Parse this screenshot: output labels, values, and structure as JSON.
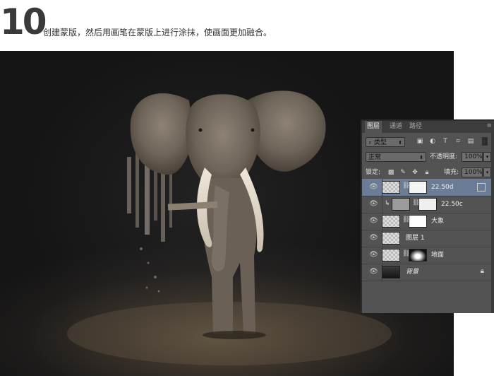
{
  "step": {
    "number": "10",
    "instruction": "创建蒙版，然后用画笔在蒙版上进行涂抹，使画面更加融合。"
  },
  "layers_panel": {
    "tabs": [
      "图层",
      "通道",
      "路径"
    ],
    "active_tab": "图层",
    "filter_label": "类型",
    "blend_mode": "正常",
    "opacity_label": "不透明度:",
    "opacity_value": "100%",
    "lock_label": "锁定:",
    "fill_label": "填充:",
    "fill_value": "100%",
    "layers": [
      {
        "name": "22.50d",
        "selected": true
      },
      {
        "name": "22.50c",
        "selected": false
      },
      {
        "name": "大象",
        "selected": false
      },
      {
        "name": "图层 1",
        "selected": false
      },
      {
        "name": "地面",
        "selected": false
      },
      {
        "name": "背景",
        "selected": false
      }
    ]
  },
  "colors": {
    "panel_bg": "#535353",
    "selected_layer": "#6b7d96",
    "step_number": "#3a3a3a"
  }
}
